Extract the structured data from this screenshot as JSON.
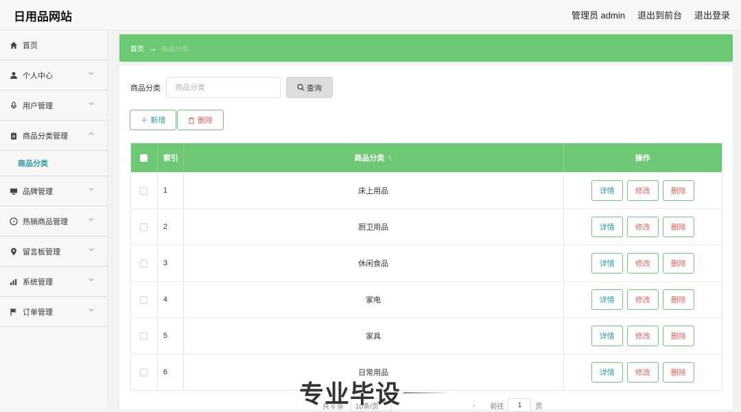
{
  "header": {
    "brand": "日用品网站",
    "links": [
      "管理员 admin",
      "退出到前台",
      "退出登录"
    ]
  },
  "sidebar": {
    "items": [
      {
        "label": "首页",
        "icon": "home-icon",
        "expandable": false
      },
      {
        "label": "个人中心",
        "icon": "user-icon",
        "expandable": true
      },
      {
        "label": "用户管理",
        "icon": "microphone-icon",
        "expandable": true
      },
      {
        "label": "商品分类管理",
        "icon": "clipboard-icon",
        "expandable": true,
        "expanded": true
      },
      {
        "label": "品牌管理",
        "icon": "monitor-icon",
        "expandable": true
      },
      {
        "label": "热销商品管理",
        "icon": "compass-icon",
        "expandable": true
      },
      {
        "label": "留言板管理",
        "icon": "location-icon",
        "expandable": true
      },
      {
        "label": "系统管理",
        "icon": "chart-icon",
        "expandable": true
      },
      {
        "label": "订单管理",
        "icon": "flag-icon",
        "expandable": true
      }
    ],
    "submenu_active": "商品分类"
  },
  "breadcrumb": {
    "home": "首页",
    "arrow": "→",
    "current": "商品分类"
  },
  "search": {
    "label": "商品分类",
    "placeholder": "商品分类",
    "value": "",
    "button": "查询"
  },
  "actions": {
    "add": "新增",
    "delete": "删除"
  },
  "table": {
    "headers": {
      "index": "索引",
      "name": "商品分类",
      "ops": "操作"
    },
    "rows": [
      {
        "index": "1",
        "name": "床上用品"
      },
      {
        "index": "2",
        "name": "厨卫用品"
      },
      {
        "index": "3",
        "name": "休闲食品"
      },
      {
        "index": "4",
        "name": "家电"
      },
      {
        "index": "5",
        "name": "家具"
      },
      {
        "index": "6",
        "name": "日常用品"
      }
    ],
    "row_ops": {
      "detail": "详情",
      "edit": "修改",
      "delete": "删除"
    }
  },
  "pagination": {
    "total": "共 6 条",
    "page_size": "10条/页",
    "next": "›",
    "goto_label": "前往",
    "page": "1",
    "page_suffix": "页"
  },
  "watermark": "专业毕设",
  "colors": {
    "accent_green": "#6cc873",
    "teal_text": "#2b9aa5",
    "danger_text": "#e0605a"
  }
}
